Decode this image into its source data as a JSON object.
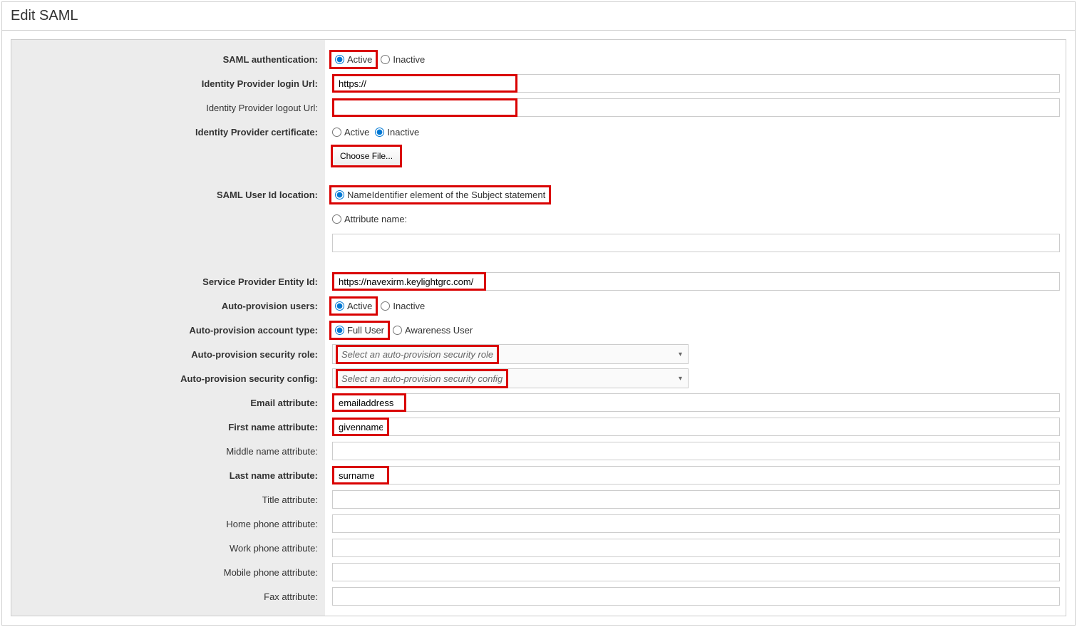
{
  "title": "Edit SAML",
  "labels": {
    "saml_auth": "SAML authentication:",
    "idp_login": "Identity Provider login Url:",
    "idp_logout": "Identity Provider logout Url:",
    "idp_cert": "Identity Provider certificate:",
    "userid_loc": "SAML User Id location:",
    "sp_entity": "Service Provider Entity Id:",
    "auto_prov_users": "Auto-provision users:",
    "auto_prov_account": "Auto-provision account type:",
    "auto_prov_role": "Auto-provision security role:",
    "auto_prov_config": "Auto-provision security config:",
    "email_attr": "Email attribute:",
    "first_name_attr": "First name attribute:",
    "middle_name_attr": "Middle name attribute:",
    "last_name_attr": "Last name attribute:",
    "title_attr": "Title attribute:",
    "home_phone_attr": "Home phone attribute:",
    "work_phone_attr": "Work phone attribute:",
    "mobile_phone_attr": "Mobile phone attribute:",
    "fax_attr": "Fax attribute:"
  },
  "radios": {
    "active": "Active",
    "inactive": "Inactive",
    "full_user": "Full User",
    "awareness_user": "Awareness User",
    "name_identifier": "NameIdentifier element of the Subject statement",
    "attribute_name": "Attribute name:"
  },
  "values": {
    "idp_login": "https://",
    "idp_logout": "",
    "sp_entity": "https://navexirm.keylightgrc.com/",
    "security_role": "Select an auto-provision security role",
    "security_config": "Select an auto-provision security config",
    "email_attr": "emailaddress",
    "first_name_attr": "givenname",
    "middle_name_attr": "",
    "last_name_attr": "surname",
    "title_attr": "",
    "home_phone_attr": "",
    "work_phone_attr": "",
    "mobile_phone_attr": "",
    "fax_attr": "",
    "attribute_name_input": ""
  },
  "buttons": {
    "choose_file": "Choose File..."
  }
}
